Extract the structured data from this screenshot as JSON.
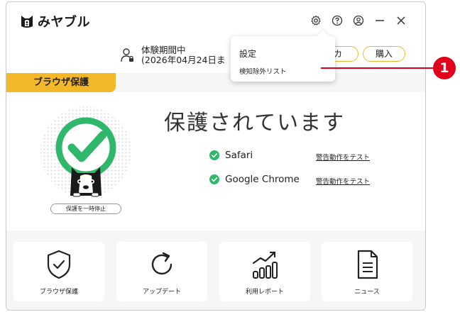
{
  "app": {
    "name": "みヤブル"
  },
  "titlebar": {
    "icons": [
      "gear-icon",
      "help-icon",
      "account-icon",
      "minimize-icon",
      "close-icon"
    ]
  },
  "user": {
    "status_line1": "体験期間中",
    "status_line2": "(2026年04月24日ま"
  },
  "buttons": {
    "activate_visible": "カ",
    "buy": "購入"
  },
  "tab": {
    "label": "ブラウザ保護"
  },
  "main": {
    "headline": "保護されています",
    "pause_label": "保護を一時停止",
    "browsers": [
      {
        "name": "Safari",
        "link": "警告動作をテスト"
      },
      {
        "name": "Google Chrome",
        "link": "警告動作をテスト"
      }
    ]
  },
  "cards": [
    {
      "label": "ブラウザ保護",
      "icon": "shield-check-icon"
    },
    {
      "label": "アップデート",
      "icon": "refresh-icon"
    },
    {
      "label": "利用レポート",
      "icon": "bar-chart-icon"
    },
    {
      "label": "ニュース",
      "icon": "document-icon"
    }
  ],
  "dropdown": {
    "items": [
      "設定",
      "検知除外リスト"
    ]
  },
  "callout": {
    "number": "1"
  },
  "colors": {
    "accent": "#f2b82a",
    "green": "#2fb86b",
    "callout": "#e0001b"
  }
}
